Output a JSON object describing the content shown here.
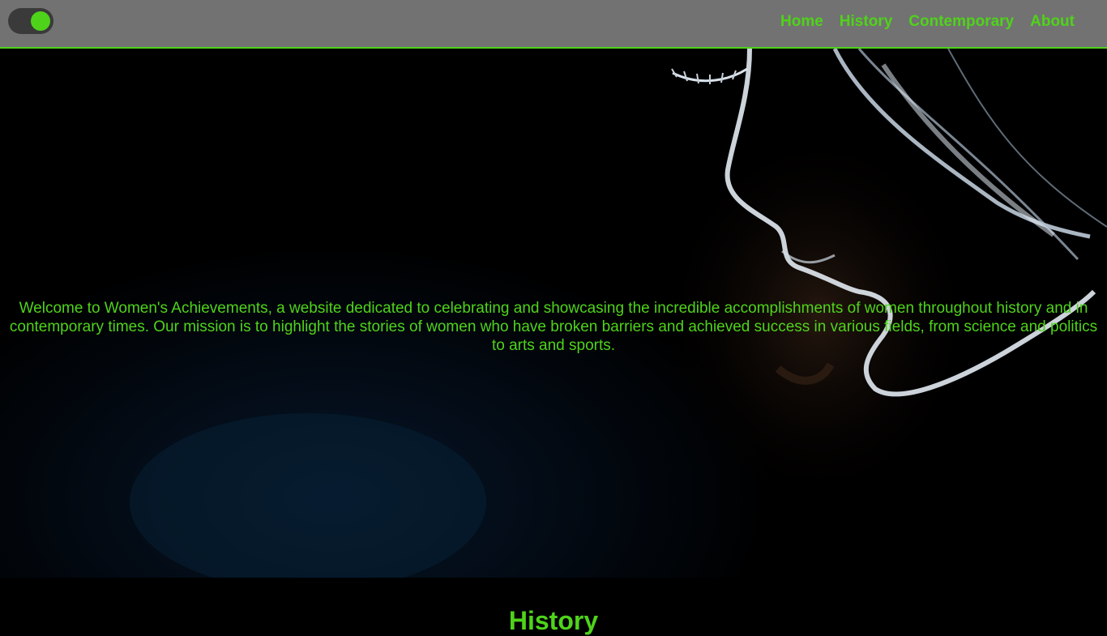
{
  "theme": {
    "accent": "#4fd31a",
    "header_bg": "#727272",
    "page_bg": "#000000"
  },
  "toggle": {
    "state": "on"
  },
  "nav": {
    "items": [
      {
        "label": "Home"
      },
      {
        "label": "History"
      },
      {
        "label": "Contemporary"
      },
      {
        "label": "About"
      }
    ]
  },
  "hero": {
    "image": "woman-profile-silhouette",
    "text": "Welcome to Women's Achievements, a website dedicated to celebrating and showcasing the incredible accomplishments of women throughout history and in contemporary times. Our mission is to highlight the stories of women who have broken barriers and achieved success in various fields, from science and politics to arts and sports."
  },
  "section": {
    "heading": "History"
  }
}
